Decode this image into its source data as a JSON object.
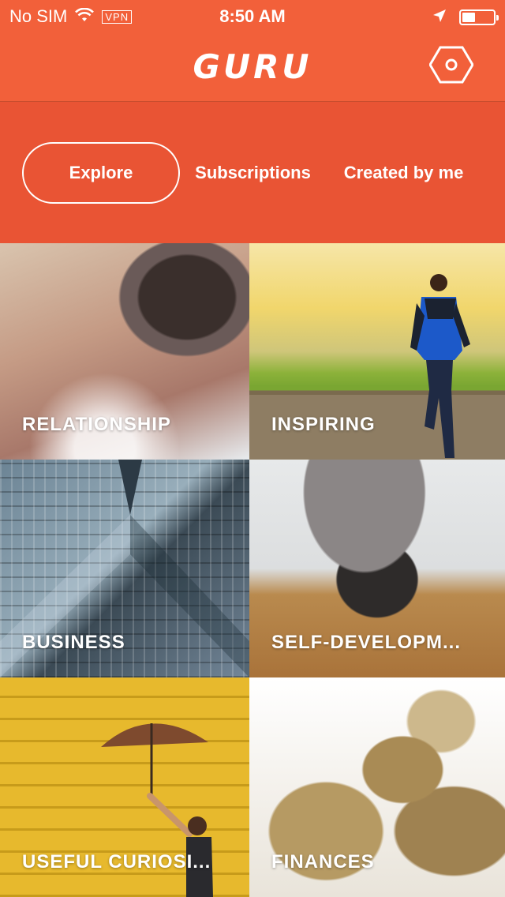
{
  "status_bar": {
    "carrier": "No SIM",
    "vpn": "VPN",
    "time": "8:50 AM"
  },
  "header": {
    "logo": "GURU",
    "settings_icon": "hexagon-settings-icon"
  },
  "tabs": [
    {
      "label": "Explore",
      "selected": true
    },
    {
      "label": "Subscriptions",
      "selected": false
    },
    {
      "label": "Created by me",
      "selected": false
    }
  ],
  "categories": [
    {
      "label": "RELATIONSHIP"
    },
    {
      "label": "INSPIRING"
    },
    {
      "label": "BUSINESS"
    },
    {
      "label": "SELF-DEVELOPM..."
    },
    {
      "label": "USEFUL CURIOSI..."
    },
    {
      "label": "FINANCES"
    }
  ],
  "colors": {
    "header_bg": "#f2603a",
    "tabs_bg": "#e95434",
    "text": "#ffffff"
  }
}
